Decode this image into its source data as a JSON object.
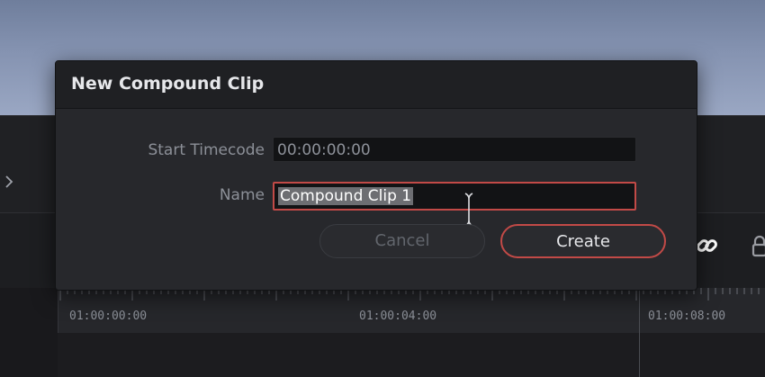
{
  "dialog": {
    "title": "New Compound Clip",
    "start_timecode_label": "Start Timecode",
    "start_timecode_value": "00:00:00:00",
    "name_label": "Name",
    "name_value": "Compound Clip 1",
    "cancel_label": "Cancel",
    "create_label": "Create"
  },
  "timeline": {
    "ruler_labels": [
      "01:00:00:00",
      "01:00:04:00",
      "01:00:08:00"
    ]
  },
  "icons": {
    "expand": "chevron-right-icon",
    "link": "link-icon",
    "lock": "lock-icon"
  },
  "colors": {
    "accent": "#c24a47",
    "dialog_bg": "#27282c",
    "header_bg": "#1f2023"
  }
}
